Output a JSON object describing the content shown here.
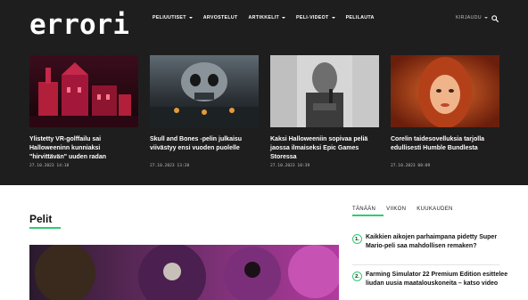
{
  "site": {
    "logo": "errori"
  },
  "nav": {
    "items": [
      {
        "label": "PELIUUTISET",
        "has_dropdown": true
      },
      {
        "label": "ARVOSTELUT",
        "has_dropdown": false
      },
      {
        "label": "ARTIKKELIT",
        "has_dropdown": true
      },
      {
        "label": "PELI-VIDEOT",
        "has_dropdown": true
      },
      {
        "label": "PELILAUTA",
        "has_dropdown": false
      }
    ],
    "auth_label": "KIRJAUDU",
    "search_icon": "search-icon"
  },
  "featured": [
    {
      "title": "Ylistetty VR-golffailu sai Halloweeninn kunniaksi \"hirvittävän\" uuden radan",
      "date": "27.10.2023 14:18"
    },
    {
      "title": "Skull and Bones -pelin julkaisu viivästyy ensi vuoden puolelle",
      "date": "27.10.2023 13:20"
    },
    {
      "title": "Kaksi Halloweeniin sopivaa peliä jaossa ilmaiseksi Epic Games Storessa",
      "date": "27.10.2023 10:39"
    },
    {
      "title": "Corelin taidesovelluksia tarjolla edullisesti Humble Bundlesta",
      "date": "27.10.2023 08:09"
    }
  ],
  "section": {
    "title": "Pelit"
  },
  "sidebar": {
    "tabs": [
      "TÄNÄÄN",
      "VIIKON",
      "KUUKAUDEN"
    ],
    "ranked": [
      {
        "num": "1.",
        "title": "Kaikkien aikojen parhaimpana pidetty Super Mario-peli saa mahdollisen remaken?"
      },
      {
        "num": "2.",
        "title": "Farming Simulator 22 Premium Edition esittelee liudan uusia maatalouskoneita – katso video"
      }
    ]
  },
  "colors": {
    "accent": "#2ecc71",
    "header_bg": "#1e1e1e"
  }
}
